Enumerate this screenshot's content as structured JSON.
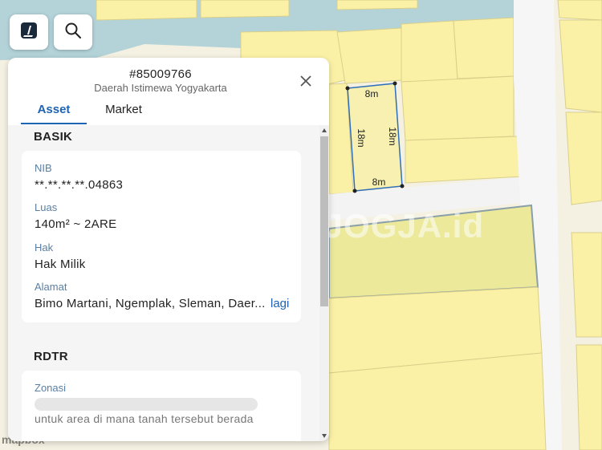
{
  "map": {
    "dim_top": "8m",
    "dim_bottom": "8m",
    "dim_left": "18m",
    "dim_right": "18m",
    "watermark": "OJOGJA.id",
    "attribution": "mapbox"
  },
  "toolbar": {
    "logo_icon": "app-logo-icon",
    "search_icon": "search-icon"
  },
  "panel": {
    "id": "#85009766",
    "region": "Daerah Istimewa Yogyakarta",
    "tabs": [
      {
        "label": "Asset",
        "active": true
      },
      {
        "label": "Market",
        "active": false
      }
    ],
    "basik": {
      "title": "BASIK",
      "fields": [
        {
          "label": "NIB",
          "value": "**.**.**.**.04863"
        },
        {
          "label": "Luas",
          "value": "140m² ~ 2ARE"
        },
        {
          "label": "Hak",
          "value": "Hak Milik"
        },
        {
          "label": "Alamat",
          "value": "Bimo Martani, Ngemplak, Sleman, Daer..."
        }
      ],
      "more_link": "lagi"
    },
    "rdtr": {
      "title": "RDTR",
      "zonasi_label": "Zonasi",
      "zonasi_hint": "untuk area di mana tanah tersebut berada"
    }
  },
  "colors": {
    "accent": "#1f63b5",
    "parcel_yellow": "#fbf1a6",
    "road": "#f3f3f3",
    "building_blue": "#a9cdd6"
  }
}
